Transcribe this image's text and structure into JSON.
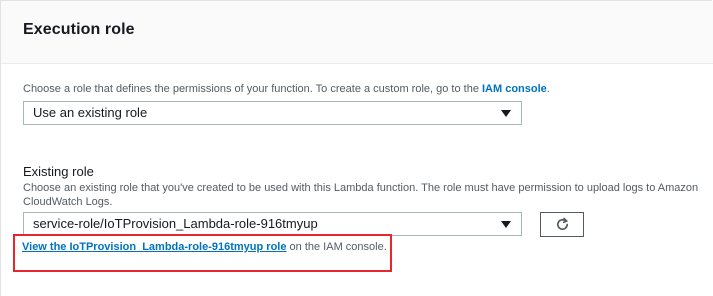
{
  "panel": {
    "title": "Execution role"
  },
  "role_choice": {
    "description_prefix": "Choose a role that defines the permissions of your function. To create a custom role, go to the ",
    "iam_console_link": "IAM console",
    "description_suffix": ".",
    "selected_value": "Use an existing role"
  },
  "existing_role": {
    "label": "Existing role",
    "description": "Choose an existing role that you've created to be used with this Lambda function. The role must have permission to upload logs to Amazon CloudWatch Logs.",
    "selected_value": "service-role/IoTProvision_Lambda-role-916tmyup",
    "view_link": "View the IoTProvision_Lambda-role-916tmyup role",
    "view_link_suffix": " on the IAM console."
  },
  "icons": {
    "dropdown": "caret-down-icon",
    "refresh": "refresh-icon"
  },
  "colors": {
    "link": "#0073bb",
    "highlight": "#e8262e"
  }
}
